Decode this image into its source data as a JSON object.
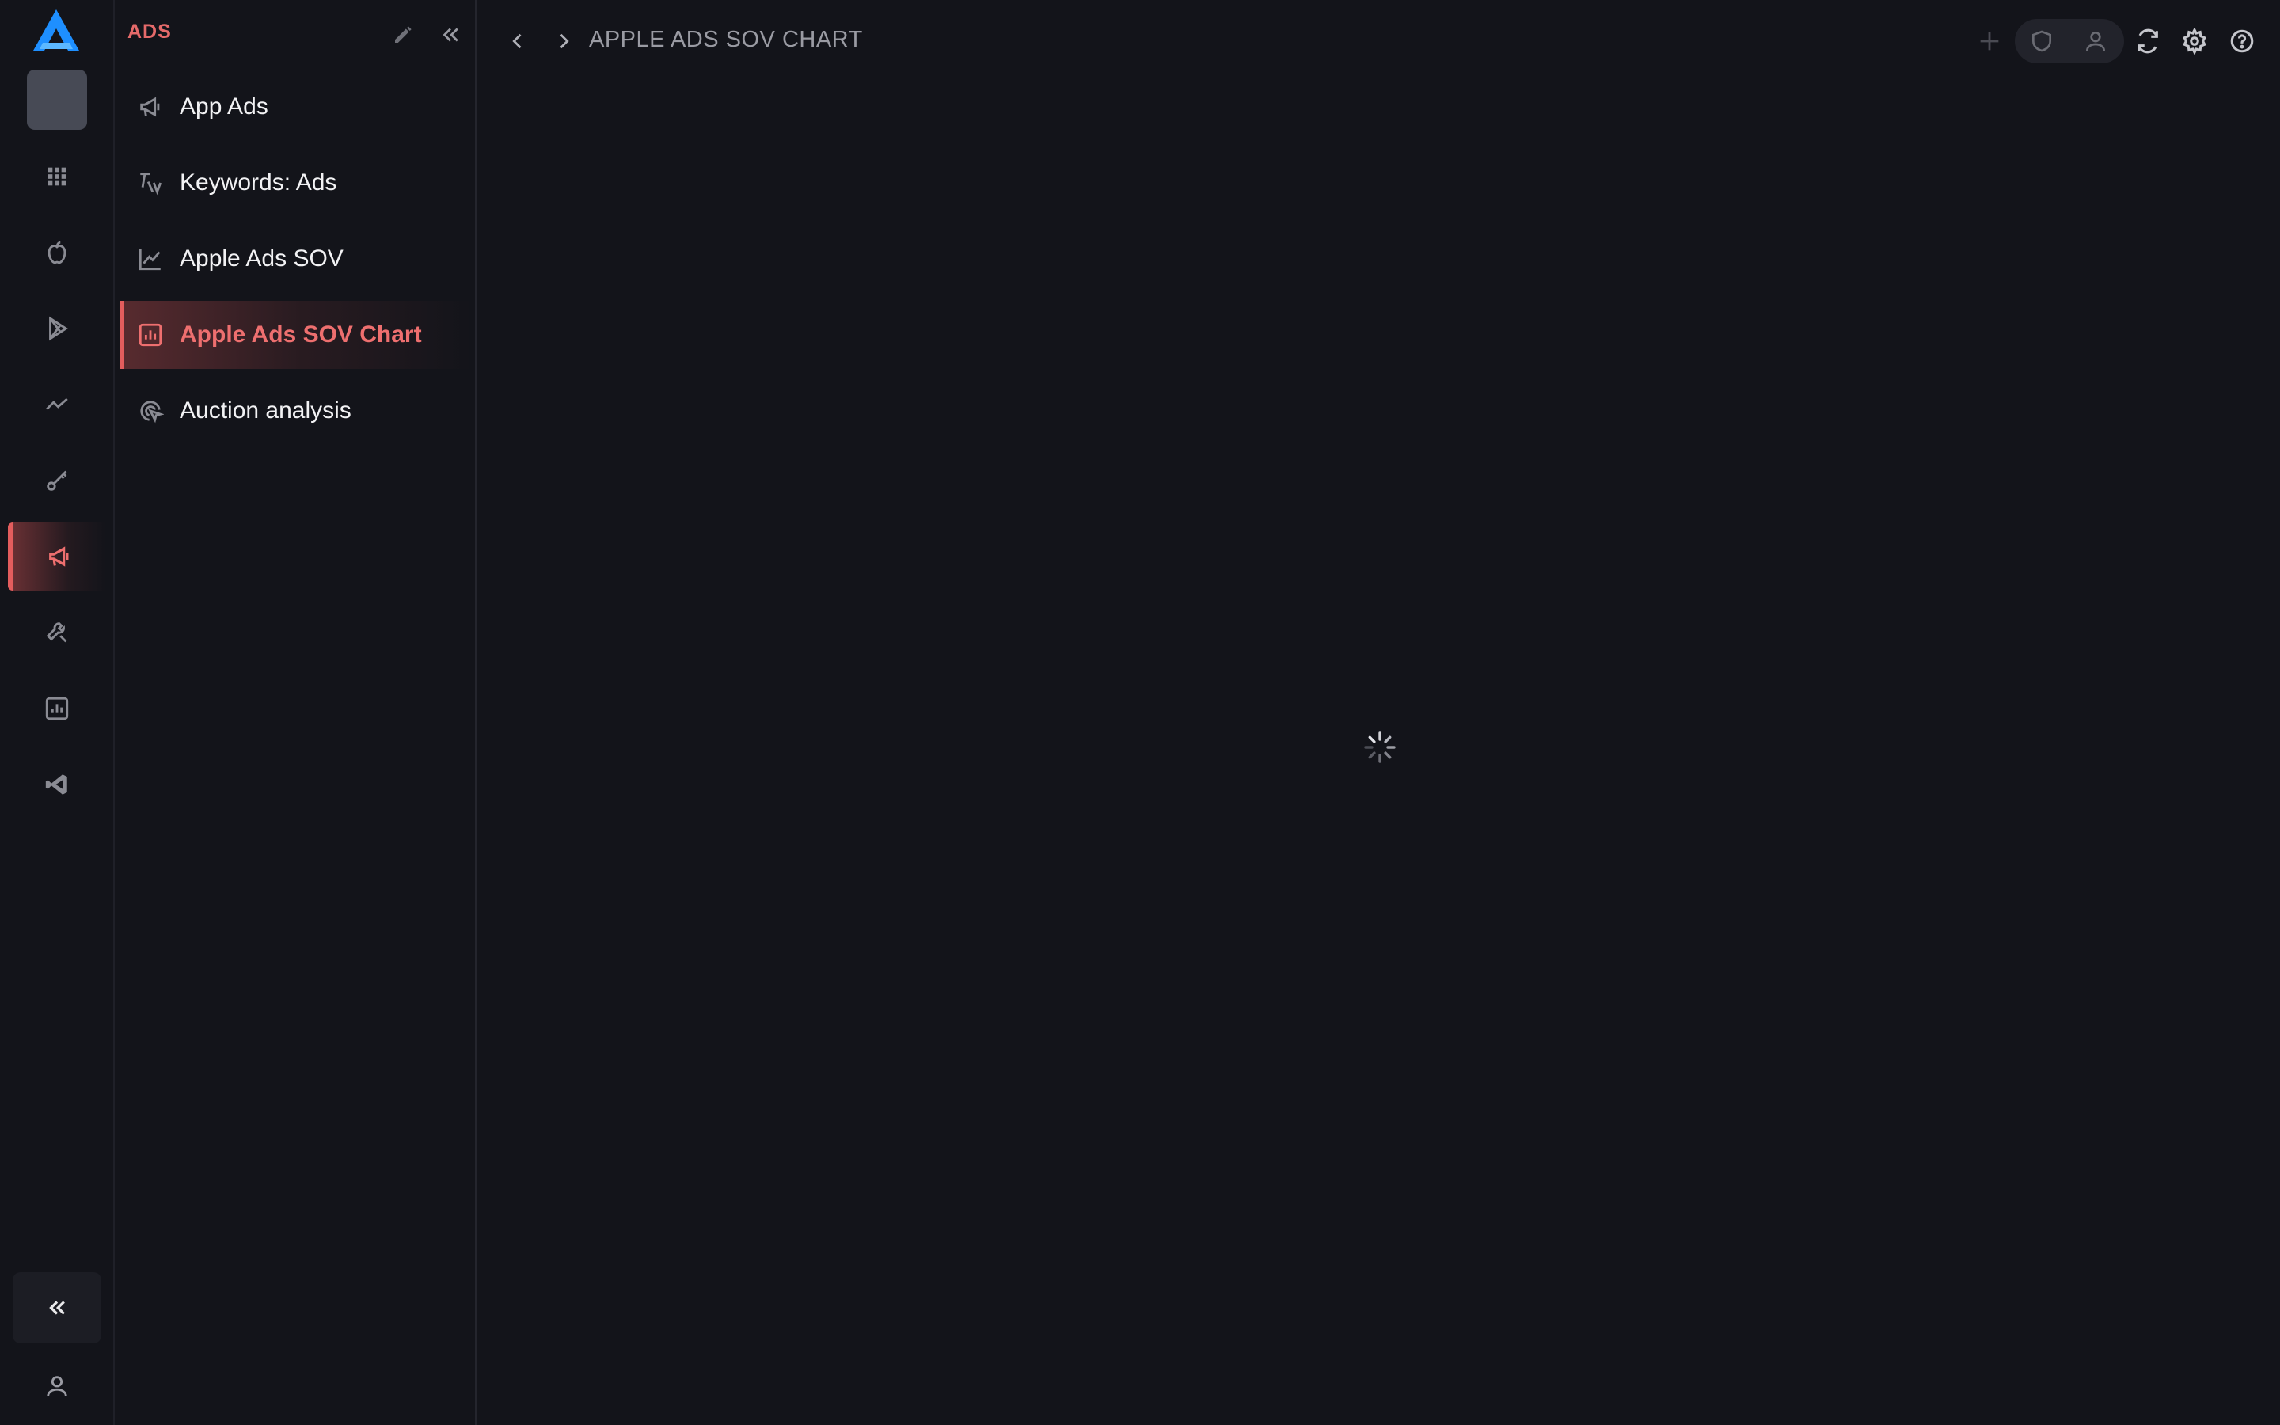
{
  "rail": {
    "items": [
      {
        "name": "apps-grid-icon",
        "active": false
      },
      {
        "name": "apple-icon",
        "active": false
      },
      {
        "name": "google-play-icon",
        "active": false
      },
      {
        "name": "trend-icon",
        "active": false
      },
      {
        "name": "key-icon",
        "active": false
      },
      {
        "name": "megaphone-icon",
        "active": true
      },
      {
        "name": "tools-icon",
        "active": false
      },
      {
        "name": "bar-chart-icon",
        "active": false
      },
      {
        "name": "vscode-icon",
        "active": false
      }
    ]
  },
  "sidebar": {
    "title": "ADS",
    "items": [
      {
        "label": "App Ads",
        "icon": "megaphone-icon",
        "active": false
      },
      {
        "label": "Keywords: Ads",
        "icon": "keyword-ads-icon",
        "active": false
      },
      {
        "label": "Apple Ads SOV",
        "icon": "line-chart-icon",
        "active": false
      },
      {
        "label": "Apple Ads SOV Chart",
        "icon": "bar-chart-icon",
        "active": true
      },
      {
        "label": "Auction analysis",
        "icon": "target-icon",
        "active": false
      }
    ]
  },
  "header": {
    "breadcrumb": "APPLE ADS SOV CHART"
  },
  "colors": {
    "background": "#13141a",
    "accent": "#e35d5d",
    "brand_blue": "#1e8fff",
    "muted_icon": "#8a8b93"
  }
}
